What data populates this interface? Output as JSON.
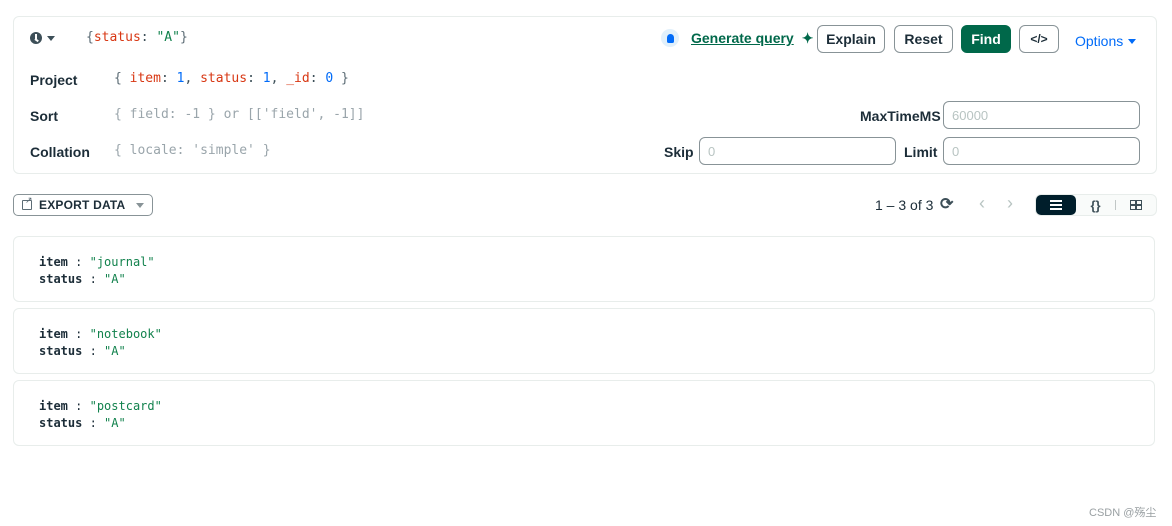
{
  "query_bar": {
    "history_icon": "clock-icon",
    "filter": {
      "open": "{",
      "key": "status",
      "colon": ": ",
      "value": "\"A\"",
      "close": "}"
    },
    "generate_query_label": "Generate query",
    "buttons": {
      "explain": "Explain",
      "reset": "Reset",
      "find": "Find",
      "code": "</>"
    },
    "options_label": "Options",
    "project": {
      "label": "Project",
      "tokens": [
        {
          "t": "{ ",
          "c": "tok-brace"
        },
        {
          "t": "item",
          "c": "tok-key"
        },
        {
          "t": ": ",
          "c": "tok-punc"
        },
        {
          "t": "1",
          "c": "tok-num"
        },
        {
          "t": ", ",
          "c": "tok-punc"
        },
        {
          "t": "status",
          "c": "tok-key"
        },
        {
          "t": ": ",
          "c": "tok-punc"
        },
        {
          "t": "1",
          "c": "tok-num"
        },
        {
          "t": ", ",
          "c": "tok-punc"
        },
        {
          "t": "_id",
          "c": "tok-key"
        },
        {
          "t": ": ",
          "c": "tok-punc"
        },
        {
          "t": "0",
          "c": "tok-num"
        },
        {
          "t": " }",
          "c": "tok-brace"
        }
      ]
    },
    "sort": {
      "label": "Sort",
      "placeholder": "{ field: -1 } or [['field', -1]]"
    },
    "collation": {
      "label": "Collation",
      "placeholder": "{ locale: 'simple' }"
    },
    "maxtimems": {
      "label": "MaxTimeMS",
      "placeholder": "60000",
      "value": ""
    },
    "skip": {
      "label": "Skip",
      "placeholder": "0",
      "value": ""
    },
    "limit": {
      "label": "Limit",
      "placeholder": "0",
      "value": ""
    }
  },
  "toolbar": {
    "export_label": "EXPORT DATA",
    "pagination": "1 – 3 of 3",
    "refresh_icon": "⟳",
    "prev_icon": "‹",
    "next_icon": "›",
    "views": {
      "list": "list-view",
      "json": "{}",
      "table": "table-view"
    },
    "active_view": "list"
  },
  "documents": [
    {
      "fields": [
        {
          "key": "item",
          "value": "\"journal\""
        },
        {
          "key": "status",
          "value": "\"A\""
        }
      ]
    },
    {
      "fields": [
        {
          "key": "item",
          "value": "\"notebook\""
        },
        {
          "key": "status",
          "value": "\"A\""
        }
      ]
    },
    {
      "fields": [
        {
          "key": "item",
          "value": "\"postcard\""
        },
        {
          "key": "status",
          "value": "\"A\""
        }
      ]
    }
  ],
  "watermark": "CSDN @殇尘",
  "colors": {
    "accent_green": "#00684a",
    "link_blue": "#016bf8",
    "key_red": "#d83713",
    "string_green": "#12824d"
  }
}
